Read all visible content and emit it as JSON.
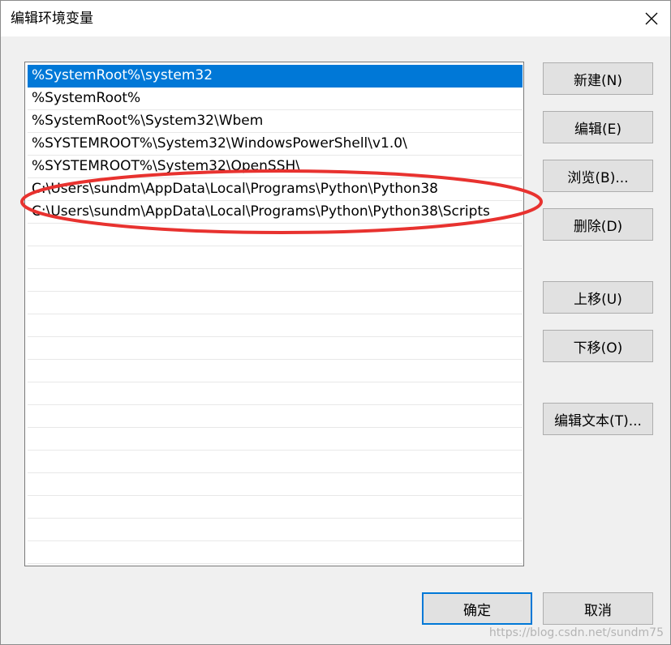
{
  "window": {
    "title": "编辑环境变量"
  },
  "list": {
    "items": [
      "%SystemRoot%\\system32",
      "%SystemRoot%",
      "%SystemRoot%\\System32\\Wbem",
      "%SYSTEMROOT%\\System32\\WindowsPowerShell\\v1.0\\",
      "%SYSTEMROOT%\\System32\\OpenSSH\\",
      "C:\\Users\\sundm\\AppData\\Local\\Programs\\Python\\Python38",
      "C:\\Users\\sundm\\AppData\\Local\\Programs\\Python\\Python38\\Scripts"
    ],
    "selected_index": 0,
    "empty_rows": 15
  },
  "buttons": {
    "new": "新建(N)",
    "edit": "编辑(E)",
    "browse": "浏览(B)...",
    "delete": "删除(D)",
    "move_up": "上移(U)",
    "move_down": "下移(O)",
    "edit_text": "编辑文本(T)...",
    "ok": "确定",
    "cancel": "取消"
  },
  "watermark": "https://blog.csdn.net/sundm75",
  "colors": {
    "selection": "#0078d7",
    "annotation": "#e8322f"
  }
}
